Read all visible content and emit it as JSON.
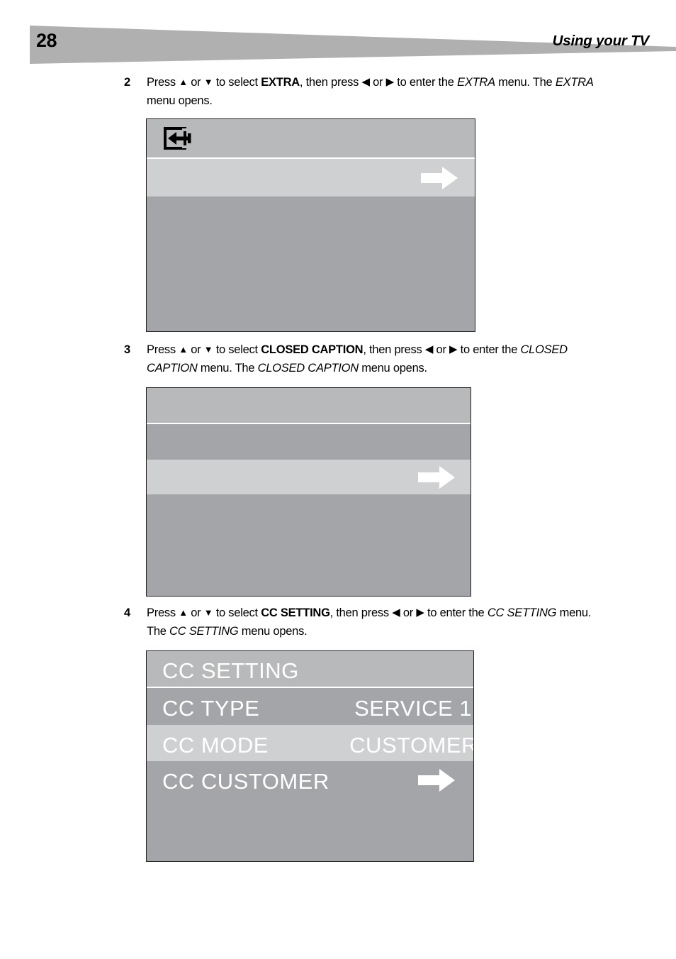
{
  "header": {
    "page_number": "28",
    "title": "Using your TV",
    "wedge_color": "#b0b0b0"
  },
  "colors": {
    "osd_header_row": "#b8b9bb",
    "osd_normal_row": "#a3a5a8",
    "osd_highlight_row": "#ced0d2",
    "osd_body": "#a3a5a8",
    "osd_text": "#ffffff",
    "osd_border": "#231f20",
    "arrow": "#ffffff",
    "icon": "#000000"
  },
  "steps": [
    {
      "number": "2",
      "segments": [
        {
          "text": "Press ",
          "style": "normal"
        },
        {
          "text": "▲",
          "style": "glyph-up"
        },
        {
          "text": " or ",
          "style": "normal"
        },
        {
          "text": "▼",
          "style": "glyph-down"
        },
        {
          "text": " to select ",
          "style": "normal"
        },
        {
          "text": "EXTRA",
          "style": "bold"
        },
        {
          "text": ", then press ",
          "style": "normal"
        },
        {
          "text": "◀",
          "style": "glyph-left"
        },
        {
          "text": " or ",
          "style": "normal"
        },
        {
          "text": "▶",
          "style": "glyph-right"
        },
        {
          "text": " to enter the ",
          "style": "normal"
        },
        {
          "text": "EXTRA",
          "style": "italic"
        },
        {
          "text": " menu. The ",
          "style": "normal"
        },
        {
          "text": "EXTRA",
          "style": "italic"
        },
        {
          "text": " menu opens.",
          "style": "normal"
        }
      ]
    },
    {
      "number": "3",
      "segments": [
        {
          "text": "Press ",
          "style": "normal"
        },
        {
          "text": "▲",
          "style": "glyph-up"
        },
        {
          "text": " or ",
          "style": "normal"
        },
        {
          "text": "▼",
          "style": "glyph-down"
        },
        {
          "text": " to select ",
          "style": "normal"
        },
        {
          "text": "CLOSED CAPTION",
          "style": "bold"
        },
        {
          "text": ", then press ",
          "style": "normal"
        },
        {
          "text": "◀",
          "style": "glyph-left"
        },
        {
          "text": " or ",
          "style": "normal"
        },
        {
          "text": "▶",
          "style": "glyph-right"
        },
        {
          "text": " to enter the ",
          "style": "normal"
        },
        {
          "text": "CLOSED CAPTION",
          "style": "italic"
        },
        {
          "text": " menu. The ",
          "style": "normal"
        },
        {
          "text": "CLOSED CAPTION",
          "style": "italic"
        },
        {
          "text": " menu opens.",
          "style": "normal"
        }
      ]
    },
    {
      "number": "4",
      "segments": [
        {
          "text": "Press ",
          "style": "normal"
        },
        {
          "text": "▲",
          "style": "glyph-up"
        },
        {
          "text": " or ",
          "style": "normal"
        },
        {
          "text": "▼",
          "style": "glyph-down"
        },
        {
          "text": " to select ",
          "style": "normal"
        },
        {
          "text": "CC SETTING",
          "style": "bold"
        },
        {
          "text": ", then press ",
          "style": "normal"
        },
        {
          "text": "◀",
          "style": "glyph-left"
        },
        {
          "text": " or ",
          "style": "normal"
        },
        {
          "text": "▶",
          "style": "glyph-right"
        },
        {
          "text": " to enter the ",
          "style": "normal"
        },
        {
          "text": "CC SETTING",
          "style": "italic"
        },
        {
          "text": " menu. The ",
          "style": "normal"
        },
        {
          "text": "CC SETTING",
          "style": "italic"
        },
        {
          "text": " menu opens.",
          "style": "normal"
        }
      ]
    }
  ],
  "menus": {
    "extra": {
      "name": "EXTRA menu",
      "icon": "input-source-icon",
      "rows": [
        {
          "label": "",
          "value": "",
          "state": "header",
          "arrow": false
        },
        {
          "label": "",
          "value": "",
          "state": "highlight",
          "arrow": true
        }
      ]
    },
    "closed_caption": {
      "name": "CLOSED CAPTION menu",
      "rows": [
        {
          "label": "",
          "value": "",
          "state": "header",
          "arrow": false
        },
        {
          "label": "",
          "value": "",
          "state": "normal",
          "arrow": false
        },
        {
          "label": "",
          "value": "",
          "state": "highlight",
          "arrow": true
        }
      ]
    },
    "cc_setting": {
      "name": "CC SETTING menu",
      "rows": [
        {
          "label": "CC SETTING",
          "value": "",
          "state": "header",
          "arrow": false
        },
        {
          "label": "CC TYPE",
          "value": "SERVICE 1",
          "state": "normal",
          "arrow": false
        },
        {
          "label": "CC MODE",
          "value": "CUSTOMER",
          "state": "highlight",
          "arrow": false
        },
        {
          "label": "CC CUSTOMER",
          "value": "",
          "state": "normal",
          "arrow": true
        }
      ]
    }
  }
}
